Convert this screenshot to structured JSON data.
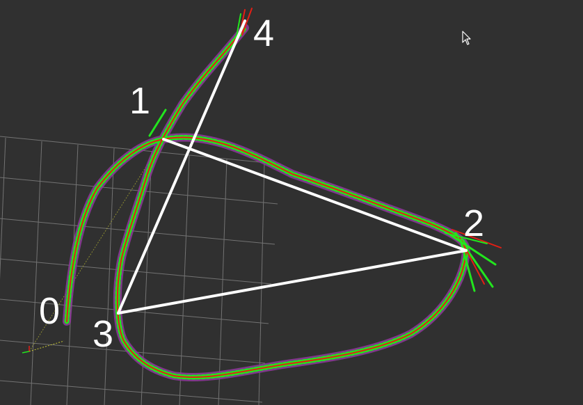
{
  "viewport": {
    "background_color": "#303030",
    "grid_color": "#8a8a8a",
    "trajectory_colors": {
      "halo": "#8e3a9a",
      "arrows": "#22e61e",
      "path": "#e51e14"
    },
    "edge_color": "#ffffff"
  },
  "graph": {
    "nodes": [
      {
        "label": "0"
      },
      {
        "label": "1"
      },
      {
        "label": "2"
      },
      {
        "label": "3"
      },
      {
        "label": "4"
      }
    ]
  },
  "cursor": {
    "icon": "mouse-pointer-icon"
  }
}
